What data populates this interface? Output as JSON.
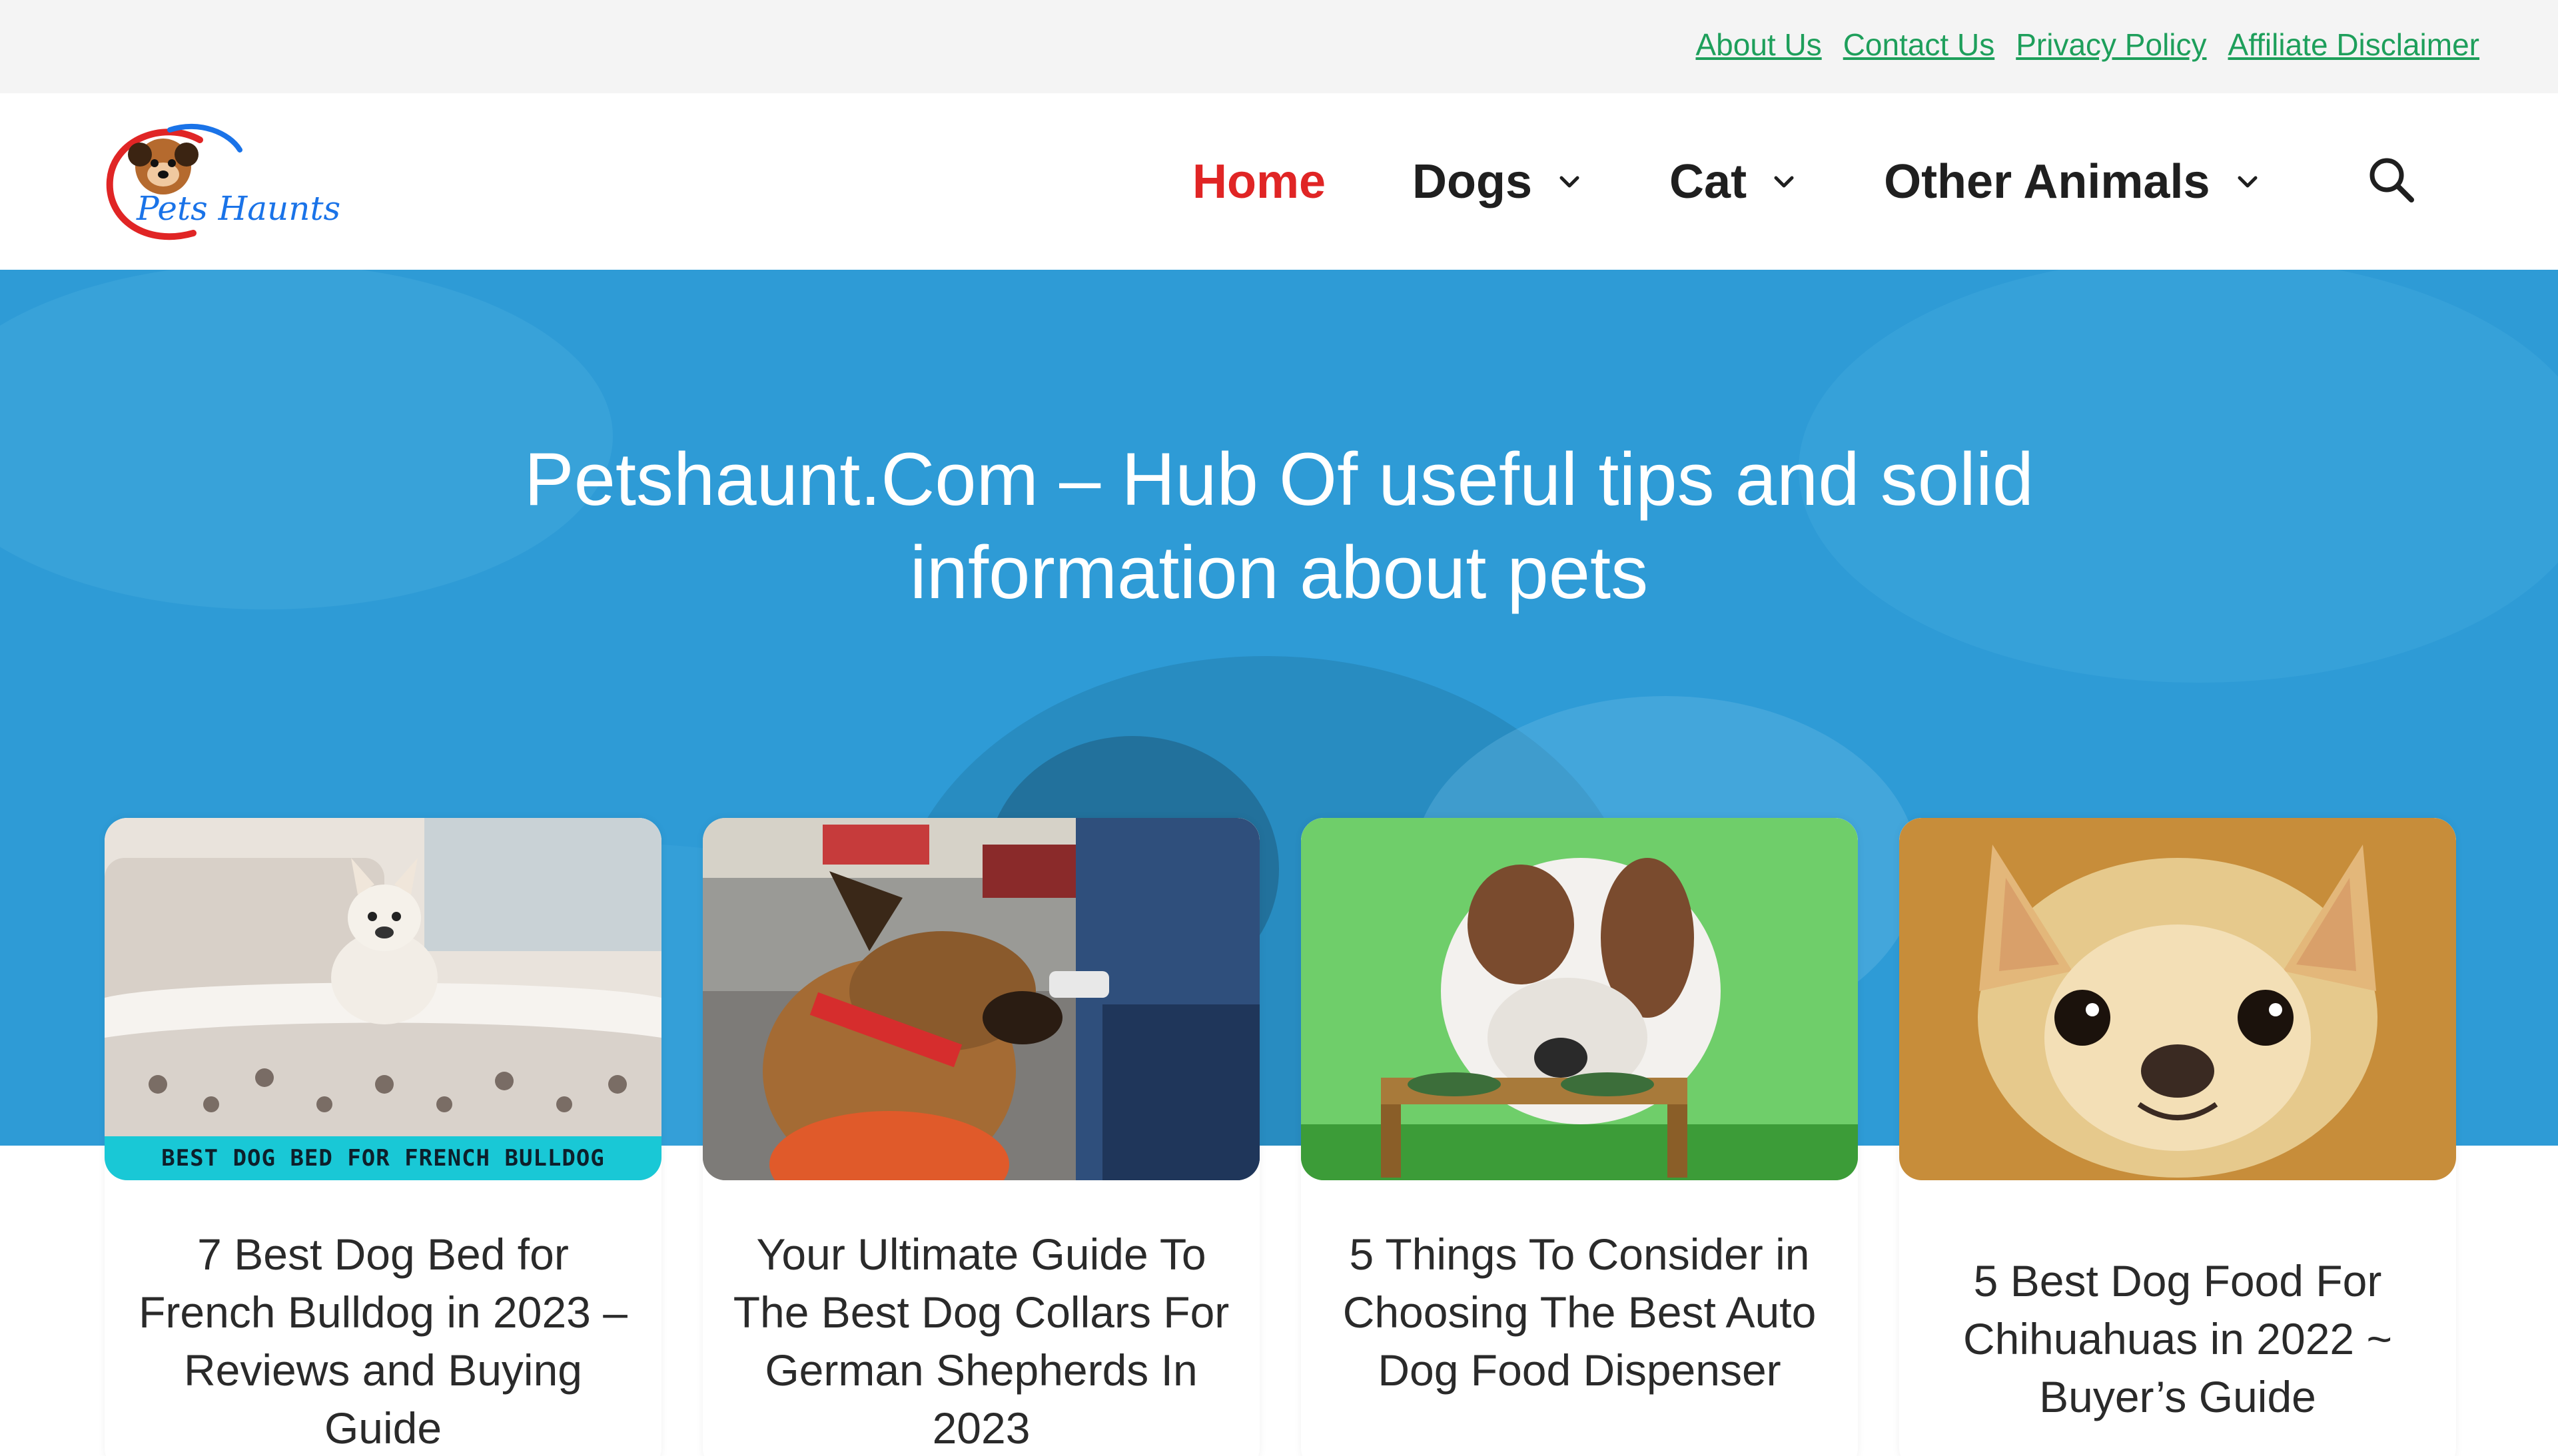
{
  "topbar": {
    "links": [
      "About Us",
      "Contact Us",
      "Privacy Policy",
      "Affiliate Disclaimer"
    ]
  },
  "header": {
    "logo_text": "Pets Haunts",
    "nav": [
      {
        "label": "Home",
        "active": true,
        "has_dropdown": false
      },
      {
        "label": "Dogs",
        "active": false,
        "has_dropdown": true
      },
      {
        "label": "Cat",
        "active": false,
        "has_dropdown": true
      },
      {
        "label": "Other Animals",
        "active": false,
        "has_dropdown": true
      }
    ],
    "search_icon": "search-icon"
  },
  "hero": {
    "title": "Petshaunt.Com – Hub Of useful tips and solid information about pets"
  },
  "cards": [
    {
      "title": "7 Best Dog Bed for French Bulldog in 2023 – Reviews and Buying Guide",
      "image_banner": "BEST DOG BED FOR FRENCH BULLDOG"
    },
    {
      "title": "Your Ultimate Guide To The Best Dog Collars For German Shepherds In 2023"
    },
    {
      "title": "5 Things To Consider in Choosing The Best Auto Dog Food Dispenser"
    },
    {
      "title": "5 Best Dog Food For Chihuahuas in 2022 ~ Buyer’s Guide"
    }
  ],
  "colors": {
    "topbar_bg": "#f4f4f4",
    "link": "#1e9f5b",
    "nav_active": "#e02525",
    "nav_text": "#1f1f1f",
    "hero_bg": "#2e9bd6",
    "banner": "#19c8d6"
  }
}
